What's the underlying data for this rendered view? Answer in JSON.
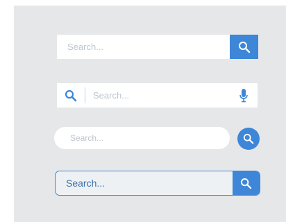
{
  "search_bars": [
    {
      "placeholder": "Search...",
      "icon": "search-icon",
      "button_color": "#3d86d8"
    },
    {
      "placeholder": "Search...",
      "leading_icon": "search-icon",
      "trailing_icon": "microphone-icon",
      "icon_color": "#3d86d8"
    },
    {
      "placeholder": "Search...",
      "icon": "search-icon",
      "button_color": "#3d86d8"
    },
    {
      "placeholder": "Search...",
      "icon": "search-icon",
      "accent": "#3d86d8"
    }
  ]
}
